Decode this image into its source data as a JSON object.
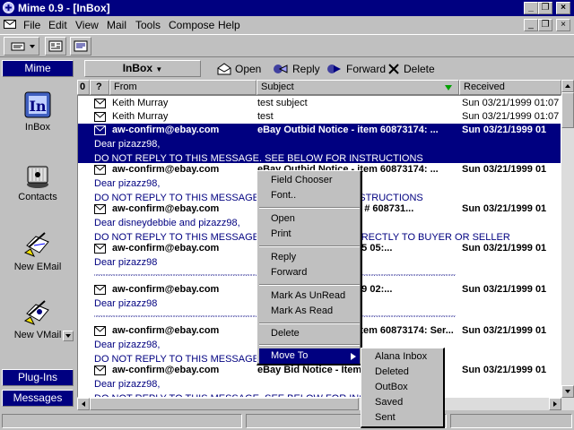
{
  "window": {
    "title": "Mime 0.9 - [InBox]"
  },
  "menu": [
    "File",
    "Edit",
    "View",
    "Mail",
    "Tools",
    "Compose",
    "Help"
  ],
  "sidebar": {
    "header": "Mime",
    "items": [
      "InBox",
      "Contacts",
      "New EMail",
      "New VMail"
    ],
    "bottom_buttons": [
      "Plug-Ins",
      "Messages"
    ]
  },
  "toolbar": {
    "folder": "InBox",
    "buttons": [
      "Open",
      "Reply",
      "Forward",
      "Delete"
    ]
  },
  "list": {
    "columns": [
      "0",
      "?",
      "From",
      "Subject",
      "Received"
    ],
    "rows": [
      {
        "from": "Keith Murray",
        "subject": "test subject",
        "received": "Sun 03/21/1999 01:07",
        "bold": false
      },
      {
        "from": "Keith Murray",
        "subject": "test",
        "received": "Sun 03/21/1999 01:07",
        "bold": false
      },
      {
        "from": "aw-confirm@ebay.com",
        "subject": "eBay Outbid Notice - item 60873174: ...",
        "received": "Sun 03/21/1999 01",
        "bold": true,
        "selected": true,
        "preview": [
          "Dear pizazz98,",
          "DO NOT REPLY TO THIS MESSAGE. SEE BELOW FOR INSTRUCTIONS"
        ]
      },
      {
        "from": "aw-confirm@ebay.com",
        "subject": "eBay Outbid Notice - item 60873174: ...",
        "received": "Sun 03/21/1999 01",
        "bold": true,
        "preview": [
          "Dear pizazz98,",
          "DO NOT REPLY TO THIS MESSAGE. SEE BELOW FOR INSTRUCTIONS"
        ]
      },
      {
        "from": "aw-confirm@ebay.com",
        "subject": "eBay Bid Notice - Item # 608731...",
        "received": "Sun 03/21/1999 01",
        "bold": true,
        "preview": [
          "Dear disneydebbie and pizazz98,",
          "DO NOT REPLY TO THIS MESSAGE. SEND YOUR MAIL DIRECTLY TO BUYER OR SELLER"
        ]
      },
      {
        "from": "aw-confirm@ebay.com",
        "subject": "eBay Notice of 02/01/95 05:...",
        "received": "Sun 03/21/1999 01",
        "bold": true,
        "preview": [
          "Dear pizazz98"
        ]
      },
      {
        "from": "aw-confirm@ebay.com",
        "subject": "eBay Notice of 01/31/99 02:...",
        "received": "Sun 03/21/1999 01",
        "bold": true,
        "preview": [
          "Dear pizazz98"
        ]
      },
      {
        "from": "aw-confirm@ebay.com",
        "subject": "eBay Outbid Notice - item 60873174: Ser...",
        "received": "Sun 03/21/1999 01",
        "bold": true,
        "preview": [
          "Dear pizazz98,",
          "DO NOT REPLY TO THIS MESSAGE. SEE BELOW FOR INSTRUCTIONS"
        ]
      },
      {
        "from": "aw-confirm@ebay.com",
        "subject": "eBay Bid Notice - Item # 608731...: Ser...",
        "received": "Sun 03/21/1999 01",
        "bold": true,
        "preview": [
          "Dear pizazz98,",
          "DO NOT REPLY TO THIS MESSAGE. SEE BELOW FOR INSTRUCTIONS"
        ]
      }
    ]
  },
  "context_menu": {
    "groups": [
      [
        "Field Chooser",
        "Font.."
      ],
      [
        "Open",
        "Print"
      ],
      [
        "Reply",
        "Forward"
      ],
      [
        "Mark As UnRead",
        "Mark As Read"
      ],
      [
        "Delete"
      ],
      [
        "Move To"
      ]
    ],
    "submenu": [
      "Alana Inbox",
      "Deleted",
      "OutBox",
      "Saved",
      "Sent"
    ]
  },
  "colors": {
    "titlebar": "#000080",
    "selection": "#000080",
    "face": "#c0c0c0",
    "preview_text": "#000080"
  }
}
